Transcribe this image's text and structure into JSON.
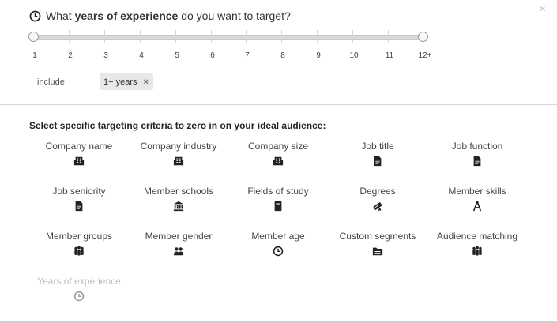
{
  "close": {
    "glyph": "×"
  },
  "question": {
    "prefix": "What ",
    "emphasis": "years of experience",
    "suffix": " do you want to target?",
    "icon": "clock-icon"
  },
  "slider": {
    "labels": [
      "1",
      "2",
      "3",
      "4",
      "5",
      "6",
      "7",
      "8",
      "9",
      "10",
      "11",
      "12+"
    ],
    "selected_min": "1",
    "selected_max": "12+"
  },
  "include": {
    "label": "include",
    "chip": "1+ years",
    "remove_glyph": "×"
  },
  "criteria": {
    "title": "Select specific targeting criteria to zero in on your ideal audience:",
    "items": [
      {
        "label": "Company name",
        "icon": "building-icon"
      },
      {
        "label": "Company industry",
        "icon": "building-icon"
      },
      {
        "label": "Company size",
        "icon": "building-icon"
      },
      {
        "label": "Job title",
        "icon": "document-icon"
      },
      {
        "label": "Job function",
        "icon": "document-icon"
      },
      {
        "label": "Job seniority",
        "icon": "document-icon"
      },
      {
        "label": "Member schools",
        "icon": "school-icon"
      },
      {
        "label": "Fields of study",
        "icon": "book-icon"
      },
      {
        "label": "Degrees",
        "icon": "diploma-icon"
      },
      {
        "label": "Member skills",
        "icon": "compass-icon"
      },
      {
        "label": "Member groups",
        "icon": "group-icon"
      },
      {
        "label": "Member gender",
        "icon": "people-icon"
      },
      {
        "label": "Member age",
        "icon": "clock-icon"
      },
      {
        "label": "Custom segments",
        "icon": "folder-icon"
      },
      {
        "label": "Audience matching",
        "icon": "group-icon"
      },
      {
        "label": "Years of experience",
        "icon": "clock-icon",
        "disabled": true
      }
    ]
  },
  "colors": {
    "icon": "#222222",
    "disabled_text": "#bdbdbd",
    "chip_bg": "#e8e8e8"
  }
}
